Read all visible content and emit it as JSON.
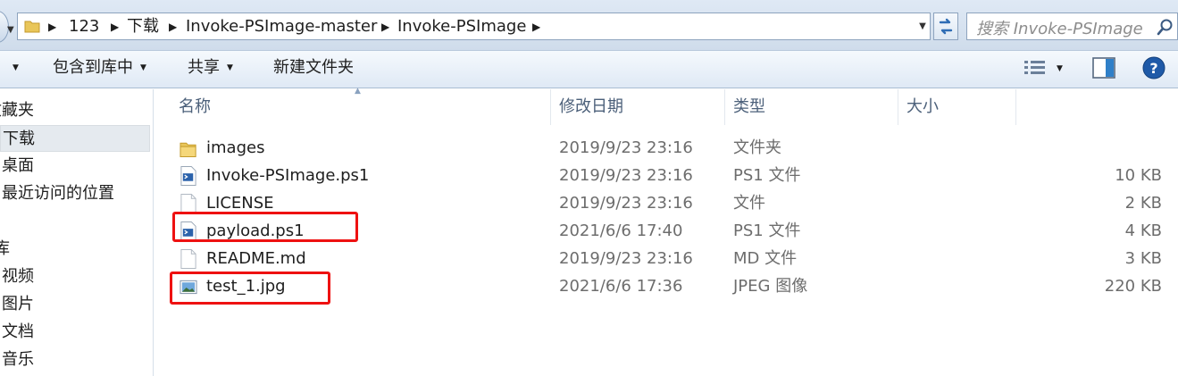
{
  "breadcrumb": [
    "123",
    "下载",
    "Invoke-PSImage-master",
    "Invoke-PSImage"
  ],
  "search": {
    "placeholder": "搜索 Invoke-PSImage"
  },
  "toolbar": {
    "include_library": "包含到库中",
    "share": "共享",
    "new_folder": "新建文件夹"
  },
  "nav": {
    "favorites": "收藏夹",
    "downloads": "下载",
    "desktop": "桌面",
    "recent": "最近访问的位置",
    "libraries": "库",
    "videos": "视频",
    "pictures": "图片",
    "documents": "文档",
    "music": "音乐"
  },
  "columns": {
    "name": "名称",
    "date": "修改日期",
    "type": "类型",
    "size": "大小"
  },
  "files": [
    {
      "name": "images",
      "date": "2019/9/23 23:16",
      "type": "文件夹",
      "size": "",
      "icon": "folder-icon"
    },
    {
      "name": "Invoke-PSImage.ps1",
      "date": "2019/9/23 23:16",
      "type": "PS1 文件",
      "size": "10 KB",
      "icon": "powershell-file-icon"
    },
    {
      "name": "LICENSE",
      "date": "2019/9/23 23:16",
      "type": "文件",
      "size": "2 KB",
      "icon": "blank-file-icon"
    },
    {
      "name": "payload.ps1",
      "date": "2021/6/6 17:40",
      "type": "PS1 文件",
      "size": "4 KB",
      "icon": "powershell-file-icon",
      "highlighted": true
    },
    {
      "name": "README.md",
      "date": "2019/9/23 23:16",
      "type": "MD 文件",
      "size": "3 KB",
      "icon": "blank-file-icon"
    },
    {
      "name": "test_1.jpg",
      "date": "2021/6/6 17:36",
      "type": "JPEG 图像",
      "size": "220 KB",
      "icon": "image-file-icon",
      "highlighted": true
    }
  ],
  "colors": {
    "highlight": "#ee1111",
    "header_text": "#4c607a",
    "selection": "#e5eaef"
  }
}
